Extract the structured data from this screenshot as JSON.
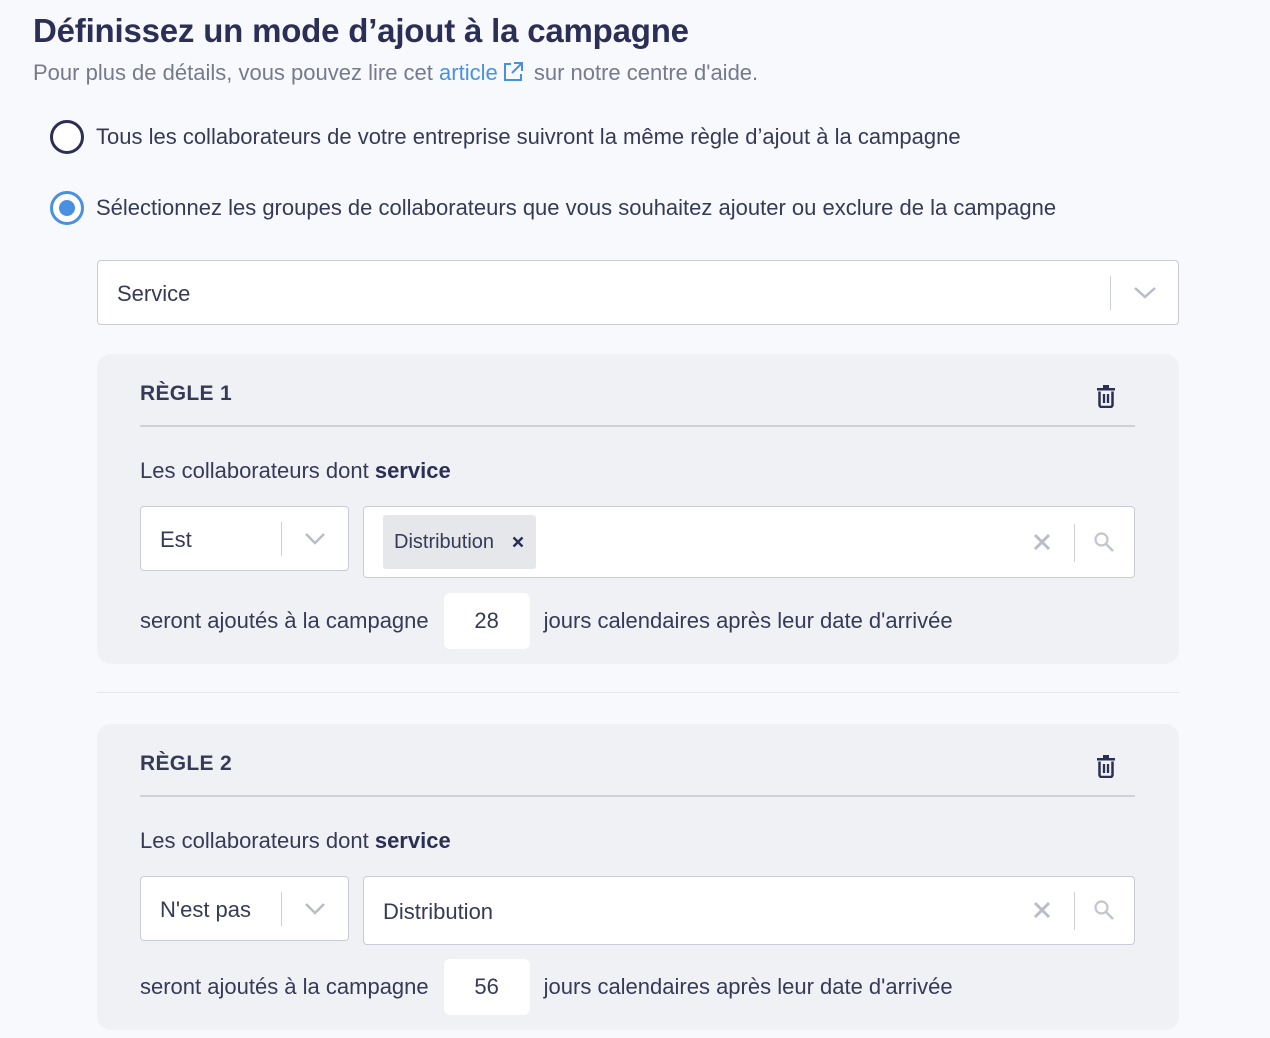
{
  "header": {
    "title": "Définissez un mode d’ajout à la campagne",
    "subtitle_before": "Pour plus de détails, vous pouvez lire cet",
    "subtitle_link": "article",
    "subtitle_after": "sur notre centre d'aide."
  },
  "options": [
    {
      "label": "Tous les collaborateurs de votre entreprise suivront la même règle d’ajout à la campagne",
      "checked": false
    },
    {
      "label": "Sélectionnez les groupes de collaborateurs que vous souhaitez ajouter ou exclure de la campagne",
      "checked": true
    }
  ],
  "group_select": {
    "value": "Service"
  },
  "rules": [
    {
      "title": "RÈGLE 1",
      "condition_prefix": "Les collaborateurs dont",
      "condition_field": "service",
      "operator": "Est",
      "chip": "Distribution",
      "days_prefix": "seront ajoutés à la campagne",
      "days": "28",
      "days_suffix": "jours calendaires après leur date d'arrivée"
    },
    {
      "title": "RÈGLE 2",
      "condition_prefix": "Les collaborateurs dont",
      "condition_field": "service",
      "operator": "N'est pas",
      "value": "Distribution",
      "days_prefix": "seront ajoutés à la campagne",
      "days": "56",
      "days_suffix": "jours calendaires après leur date d'arrivée"
    }
  ],
  "colors": {
    "accent": "#4a90e2",
    "title": "#2c2f55",
    "panel": "#f0f1f5"
  }
}
